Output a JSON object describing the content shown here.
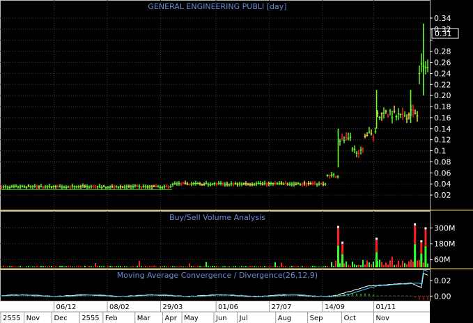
{
  "chart_data": [
    {
      "type": "bar",
      "title": "GENERAL ENGINEERING PUBLI [day]",
      "ylim": [
        0,
        0.35
      ],
      "yticks": [
        0.02,
        0.04,
        0.06,
        0.08,
        0.1,
        0.12,
        0.14,
        0.16,
        0.18,
        0.2,
        0.22,
        0.24,
        0.26,
        0.28,
        0.3,
        0.32,
        0.34
      ],
      "ytick_labels": [
        "0.02",
        "0.04",
        "0.06",
        "0.08",
        "0.1",
        "0.12",
        "0.14",
        "0.16",
        "0.18",
        "0.20",
        "0.22",
        "0.24",
        "0.26",
        "0.28",
        "",
        "0.32",
        "0.34"
      ],
      "last_price_label": "0.31",
      "last_price": 0.31,
      "grid": true,
      "up_color": "#66ff33",
      "down_color": "#ff2020",
      "price_segments": [
        {
          "from": 0,
          "to": 0.4,
          "level": 0.035
        },
        {
          "from": 0.4,
          "to": 0.76,
          "level": 0.04
        },
        {
          "from": 0.76,
          "to": 0.79,
          "level": 0.055
        },
        {
          "from": 0.79,
          "to": 0.82,
          "level": 0.12
        },
        {
          "from": 0.82,
          "to": 0.85,
          "level": 0.1
        },
        {
          "from": 0.85,
          "to": 0.88,
          "level": 0.13
        },
        {
          "from": 0.88,
          "to": 0.96,
          "level": 0.165
        },
        {
          "from": 0.96,
          "to": 0.98,
          "level": 0.17
        },
        {
          "from": 0.98,
          "to": 1.0,
          "level": 0.25
        }
      ],
      "price_spikes": [
        {
          "at": 0.79,
          "high": 0.14,
          "low": 0.07
        },
        {
          "at": 0.88,
          "high": 0.21,
          "low": 0.14
        },
        {
          "at": 0.96,
          "high": 0.21,
          "low": 0.15
        },
        {
          "at": 0.99,
          "high": 0.33,
          "low": 0.2
        }
      ]
    },
    {
      "type": "bar",
      "title": "Buy/Sell Volume Analysis",
      "yticks": [
        60000000,
        180000000,
        300000000
      ],
      "ytick_labels": [
        "60M",
        "180M",
        "300M"
      ],
      "ylim": [
        0,
        340000000
      ],
      "up_color": "#33ff33",
      "down_color": "#ff2020",
      "spikes": [
        {
          "at": 0.79,
          "value": 300000000
        },
        {
          "at": 0.8,
          "value": 180000000
        },
        {
          "at": 0.88,
          "value": 210000000
        },
        {
          "at": 0.97,
          "value": 320000000
        },
        {
          "at": 0.985,
          "value": 190000000
        },
        {
          "at": 0.995,
          "value": 290000000
        }
      ]
    },
    {
      "type": "line",
      "title": "Moving Average Convergence / Divergence(26,12,9)",
      "yticks": [
        0,
        0.02
      ],
      "ytick_labels": [
        "0.00",
        "0.02"
      ],
      "ylim": [
        -0.006,
        0.03
      ],
      "colors": [
        "#ffffff",
        "#33ccff",
        "#66ff33"
      ]
    }
  ],
  "time_axis": {
    "date_labels": [
      {
        "text": "06/12",
        "at": 0.13
      },
      {
        "text": "08/02",
        "at": 0.255
      },
      {
        "text": "29/03",
        "at": 0.38
      },
      {
        "text": "01/06",
        "at": 0.51
      },
      {
        "text": "27/07",
        "at": 0.635
      },
      {
        "text": "14/09",
        "at": 0.76
      },
      {
        "text": "01/11",
        "at": 0.88
      }
    ],
    "month_labels": [
      {
        "text": "2555",
        "at": 0.0
      },
      {
        "text": "Nov",
        "at": 0.055
      },
      {
        "text": "Dec",
        "at": 0.12
      },
      {
        "text": "2555",
        "at": 0.185
      },
      {
        "text": "Feb",
        "at": 0.24
      },
      {
        "text": "Mar",
        "at": 0.315
      },
      {
        "text": "Apr",
        "at": 0.38
      },
      {
        "text": "May",
        "at": 0.425
      },
      {
        "text": "Jun",
        "at": 0.5
      },
      {
        "text": "Jul",
        "at": 0.555
      },
      {
        "text": "Aug",
        "at": 0.645
      },
      {
        "text": "Sep",
        "at": 0.72
      },
      {
        "text": "Oct",
        "at": 0.8
      },
      {
        "text": "Nov",
        "at": 0.875
      }
    ]
  }
}
